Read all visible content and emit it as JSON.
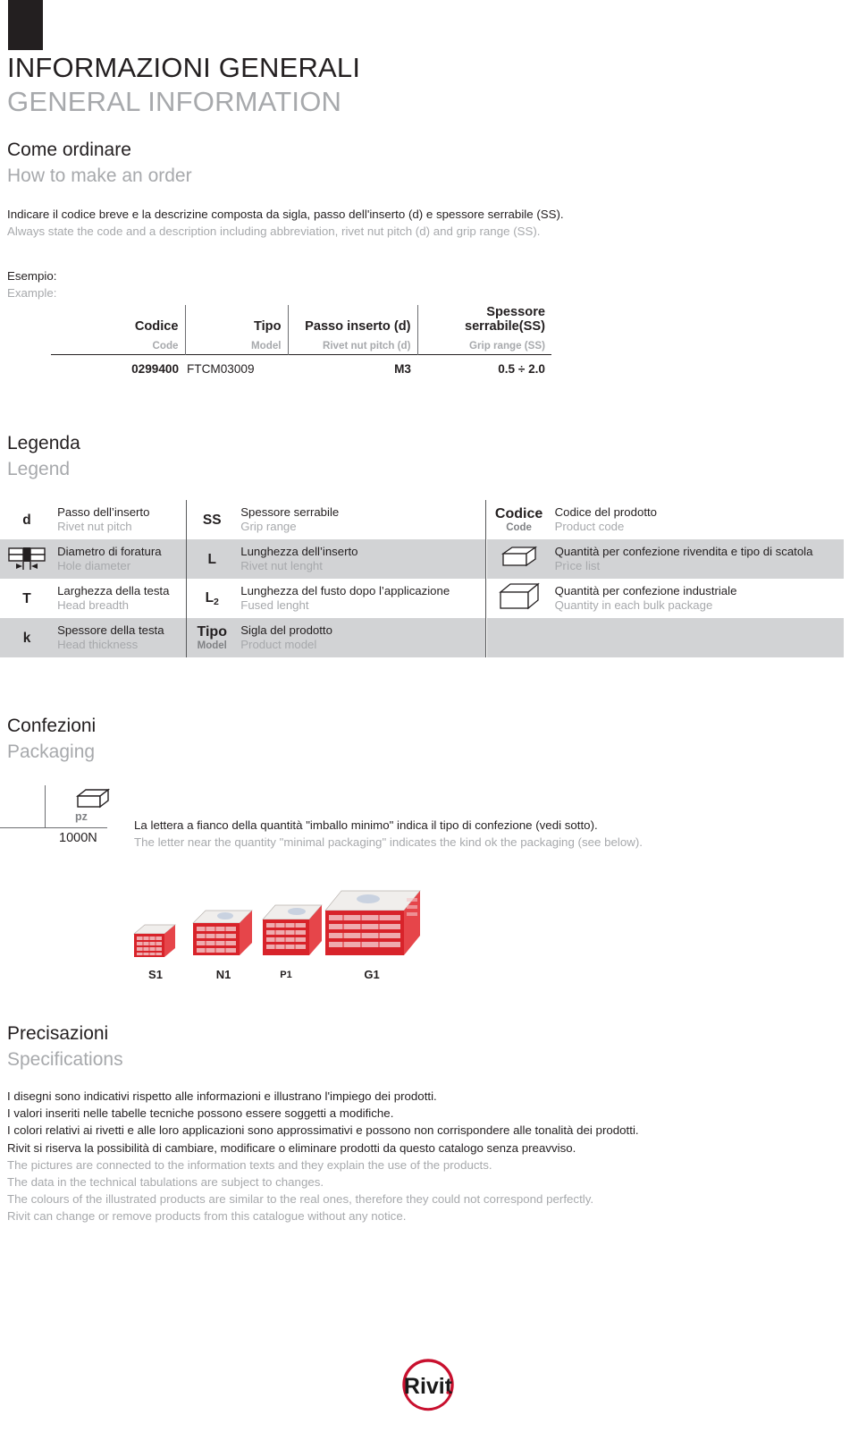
{
  "header": {
    "title_it": "INFORMAZIONI GENERALI",
    "title_en": "GENERAL INFORMATION"
  },
  "order_section": {
    "heading_it": "Come ordinare",
    "heading_en": "How to make an order",
    "intro_it": "Indicare il codice breve e la descrizine composta da sigla, passo dell'inserto (d) e spessore serrabile (SS).",
    "intro_en": "Always state the code and a description including abbreviation, rivet nut pitch (d) and grip range (SS).",
    "example_label_it": "Esempio:",
    "example_label_en": "Example:",
    "table": {
      "headers_it": [
        "Codice",
        "Tipo",
        "Passo inserto (d)",
        "Spessore serrabile(SS)"
      ],
      "headers_en": [
        "Code",
        "Model",
        "Rivet nut pitch (d)",
        "Grip range (SS)"
      ],
      "row": [
        "0299400",
        "FTCM03009",
        "M3",
        "0.5 ÷ 2.0"
      ]
    }
  },
  "legend_section": {
    "heading_it": "Legenda",
    "heading_en": "Legend",
    "rows": [
      {
        "c1": {
          "sym_it": "d",
          "sym_en": "",
          "icon": "",
          "it": "Passo dell’inserto",
          "en": "Rivet nut pitch"
        },
        "c2": {
          "sym_it": "SS",
          "sym_en": "",
          "icon": "",
          "it": "Spessore serrabile",
          "en": "Grip range"
        },
        "c3": {
          "sym_it": "Codice",
          "sym_en": "Code",
          "icon": "",
          "it": "Codice del prodotto",
          "en": "Product code"
        }
      },
      {
        "c1": {
          "sym_it": "",
          "sym_en": "",
          "icon": "hole-diameter-icon",
          "it": "Diametro di foratura",
          "en": "Hole diameter"
        },
        "c2": {
          "sym_it": "L",
          "sym_en": "",
          "icon": "",
          "it": "Lunghezza dell’inserto",
          "en": "Rivet nut lenght"
        },
        "c3": {
          "sym_it": "",
          "sym_en": "",
          "icon": "small-box-icon",
          "it": "Quantità per confezione rivendita e tipo di scatola",
          "en": "Prìce list"
        }
      },
      {
        "c1": {
          "sym_it": "T",
          "sym_en": "",
          "icon": "",
          "it": "Larghezza della testa",
          "en": "Head breadth"
        },
        "c2": {
          "sym_it": "L2",
          "sym_en": "",
          "icon": "",
          "it": "Lunghezza del fusto dopo l’applicazione",
          "en": "Fused lenght"
        },
        "c3": {
          "sym_it": "",
          "sym_en": "",
          "icon": "large-box-icon",
          "it": "Quantità per confezione industriale",
          "en": "Quantity in each bulk package"
        }
      },
      {
        "c1": {
          "sym_it": "k",
          "sym_en": "",
          "icon": "",
          "it": "Spessore della testa",
          "en": "Head thickness"
        },
        "c2": {
          "sym_it": "Tipo",
          "sym_en": "Model",
          "icon": "",
          "it": "Sigla del prodotto",
          "en": "Product model"
        },
        "c3": {
          "sym_it": "",
          "sym_en": "",
          "icon": "",
          "it": "",
          "en": ""
        }
      }
    ]
  },
  "packaging_section": {
    "heading_it": "Confezioni",
    "heading_en": "Packaging",
    "symbol": {
      "unit": "pz",
      "quantity": "1000N",
      "icon": "small-box-icon"
    },
    "note_it": "La lettera a fianco della quantità \"imballo minimo\" indica il tipo di confezione (vedi sotto).",
    "note_en": "The letter near the quantity \"minimal packaging\" indicates the kind ok the packaging (see below).",
    "box_labels": [
      "S1",
      "N1",
      "P1",
      "G1"
    ]
  },
  "specs_section": {
    "heading_it": "Precisazioni",
    "heading_en": "Specifications",
    "lines_it": [
      "I disegni sono indicativi rispetto alle informazioni e illustrano l'impiego dei prodotti.",
      "I valori inseriti nelle tabelle tecniche possono essere soggetti a modifiche.",
      "I colori relativi ai rivetti e alle loro applicazioni sono approssimativi e possono non corrispondere alle tonalità dei prodotti.",
      "Rivit si riserva la possibilità di cambiare, modificare o eliminare prodotti da questo catalogo senza preavviso."
    ],
    "lines_en": [
      "The pictures are connected to the information texts and they explain the use of the products.",
      "The data in the technical tabulations are subject to changes.",
      "The colours of the illustrated products are similar to the real ones, therefore they could not correspond perfectly.",
      "Rivit can change or remove products from this catalogue without any notice."
    ]
  },
  "logo": {
    "text": "Rivit",
    "ring_color": "#c8102e",
    "text_color": "#1a1a1a"
  },
  "colors": {
    "dark": "#231f20",
    "light_gray_text": "#a7a9ac",
    "row_shade": "#d2d3d5",
    "divider": "#58595b",
    "box_red": "#d8232a"
  }
}
